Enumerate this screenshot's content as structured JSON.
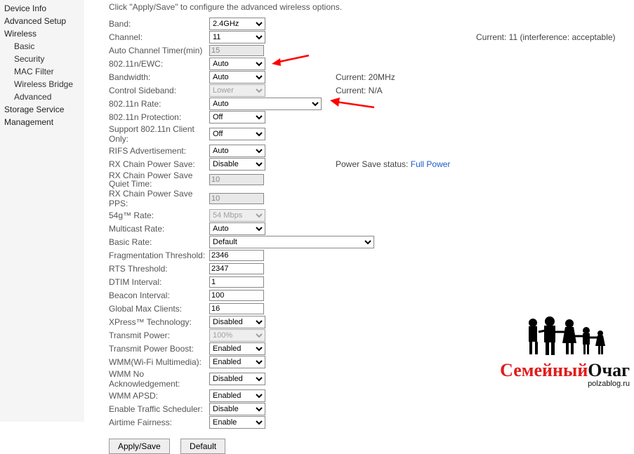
{
  "sidebar": {
    "device_info": "Device Info",
    "advanced_setup": "Advanced Setup",
    "wireless": "Wireless",
    "basic": "Basic",
    "security": "Security",
    "mac_filter": "MAC Filter",
    "wireless_bridge": "Wireless Bridge",
    "advanced": "Advanced",
    "storage": "Storage Service",
    "management": "Management"
  },
  "intro": "Click \"Apply/Save\" to configure the advanced wireless options.",
  "labels": {
    "band": "Band:",
    "channel": "Channel:",
    "auto_channel_timer": "Auto Channel Timer(min)",
    "ewc": "802.11n/EWC:",
    "bandwidth": "Bandwidth:",
    "sideband": "Control Sideband:",
    "rate11n": "802.11n Rate:",
    "prot11n": "802.11n Protection:",
    "client_only": "Support 802.11n Client Only:",
    "rifs": "RIFS Advertisement:",
    "rx_ps": "RX Chain Power Save:",
    "rx_ps_quiet": "RX Chain Power Save Quiet Time:",
    "rx_ps_pps": "RX Chain Power Save PPS:",
    "rate54g": "54g™ Rate:",
    "multicast": "Multicast Rate:",
    "basic_rate": "Basic Rate:",
    "frag": "Fragmentation Threshold:",
    "rts": "RTS Threshold:",
    "dtim": "DTIM Interval:",
    "beacon": "Beacon Interval:",
    "max_clients": "Global Max Clients:",
    "xpress": "XPress™ Technology:",
    "tx_power": "Transmit Power:",
    "tx_boost": "Transmit Power Boost:",
    "wmm": "WMM(Wi-Fi Multimedia):",
    "wmm_noack": "WMM No Acknowledgement:",
    "wmm_apsd": "WMM APSD:",
    "traffic_sched": "Enable Traffic Scheduler:",
    "airtime": "Airtime Fairness:"
  },
  "values": {
    "band": "2.4GHz",
    "channel": "11",
    "auto_channel_timer": "15",
    "ewc": "Auto",
    "bandwidth": "Auto",
    "sideband": "Lower",
    "rate11n": "Auto",
    "prot11n": "Off",
    "client_only": "Off",
    "rifs": "Auto",
    "rx_ps": "Disable",
    "rx_ps_quiet": "10",
    "rx_ps_pps": "10",
    "rate54g": "54 Mbps",
    "multicast": "Auto",
    "basic_rate": "Default",
    "frag": "2346",
    "rts": "2347",
    "dtim": "1",
    "beacon": "100",
    "max_clients": "16",
    "xpress": "Disabled",
    "tx_power": "100%",
    "tx_boost": "Enabled",
    "wmm": "Enabled",
    "wmm_noack": "Disabled",
    "wmm_apsd": "Enabled",
    "traffic_sched": "Disable",
    "airtime": "Enable"
  },
  "extra": {
    "channel_current": "Current: 11 (interference: acceptable)",
    "bw_current": "Current: 20MHz",
    "sb_current": "Current: N/A",
    "ps_status_label": "Power Save status:",
    "ps_status_value": "Full Power"
  },
  "buttons": {
    "apply": "Apply/Save",
    "default": "Default"
  },
  "watermark": {
    "red": "Семейный",
    "black": "Очаг",
    "sub": "polzablog.ru"
  }
}
